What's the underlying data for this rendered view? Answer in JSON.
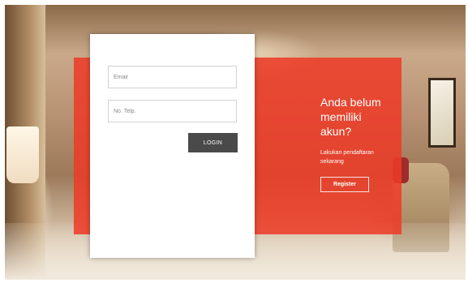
{
  "login": {
    "email_placeholder": "Email",
    "phone_placeholder": "No. Telp.",
    "login_label": "LOGIN"
  },
  "promo": {
    "heading": "Anda belum memiliki akun?",
    "subtext": "Lakukan pendaftaran sekarang",
    "register_label": "Register"
  },
  "colors": {
    "panel_red": "#ee3a26",
    "login_button": "#4a4a4a",
    "card": "#ffffff"
  }
}
